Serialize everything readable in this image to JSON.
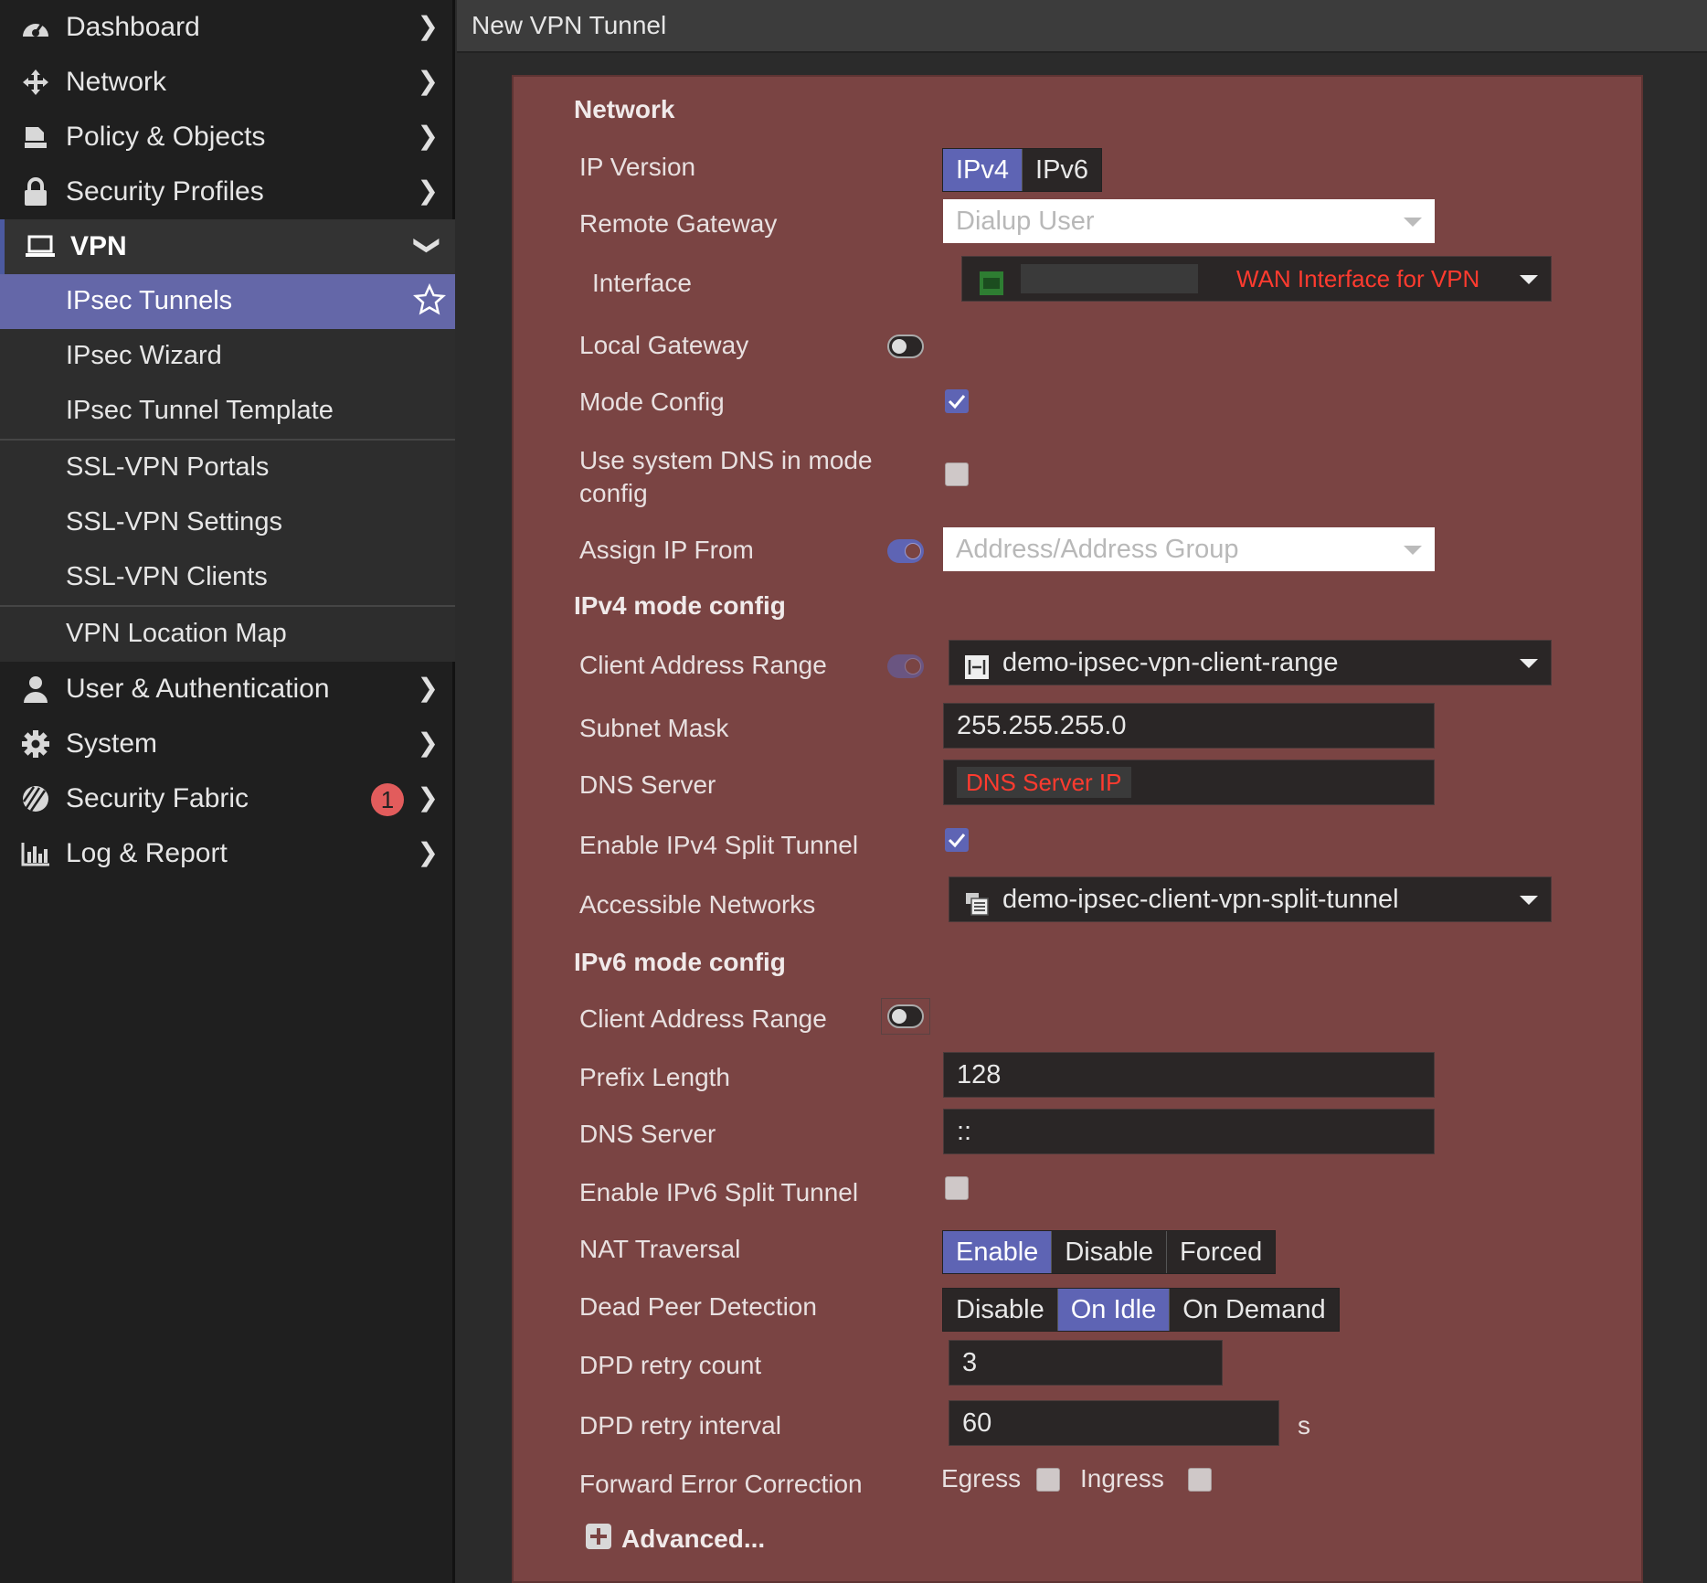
{
  "sidebar": {
    "items": [
      {
        "label": "Dashboard",
        "icon": "dashboard-icon"
      },
      {
        "label": "Network",
        "icon": "network-icon"
      },
      {
        "label": "Policy & Objects",
        "icon": "policy-icon"
      },
      {
        "label": "Security Profiles",
        "icon": "lock-icon"
      },
      {
        "label": "VPN",
        "icon": "laptop-icon"
      },
      {
        "label": "User & Authentication",
        "icon": "user-icon"
      },
      {
        "label": "System",
        "icon": "gear-icon"
      },
      {
        "label": "Security Fabric",
        "icon": "fabric-icon",
        "badge": "1"
      },
      {
        "label": "Log & Report",
        "icon": "chart-icon"
      }
    ],
    "vpn_sub": [
      {
        "label": "IPsec Tunnels"
      },
      {
        "label": "IPsec Wizard"
      },
      {
        "label": "IPsec Tunnel Template"
      },
      {
        "label": "SSL-VPN Portals"
      },
      {
        "label": "SSL-VPN Settings"
      },
      {
        "label": "SSL-VPN Clients"
      },
      {
        "label": "VPN Location Map"
      }
    ]
  },
  "header": {
    "title": "New VPN Tunnel"
  },
  "form": {
    "network_section": "Network",
    "ip_version_label": "IP Version",
    "ip_version_options": [
      "IPv4",
      "IPv6"
    ],
    "ip_version_selected": "IPv4",
    "remote_gateway_label": "Remote Gateway",
    "remote_gateway_value": "Dialup User",
    "interface_label": "Interface",
    "interface_annotation": "WAN Interface for VPN",
    "local_gateway_label": "Local Gateway",
    "mode_config_label": "Mode Config",
    "use_system_dns_label_1": "Use system DNS in mode",
    "use_system_dns_label_2": "config",
    "assign_ip_from_label": "Assign IP From",
    "assign_ip_from_value": "Address/Address Group",
    "ipv4_section": "IPv4 mode config",
    "client_address_range_label": "Client Address Range",
    "client_address_range_value": "demo-ipsec-vpn-client-range",
    "subnet_mask_label": "Subnet Mask",
    "subnet_mask_value": "255.255.255.0",
    "dns_server_label": "DNS Server",
    "dns_server_annotation": "DNS Server IP",
    "enable_ipv4_split_label": "Enable IPv4 Split Tunnel",
    "accessible_networks_label": "Accessible Networks",
    "accessible_networks_value": "demo-ipsec-client-vpn-split-tunnel",
    "ipv6_section": "IPv6 mode config",
    "ipv6_client_address_range_label": "Client Address Range",
    "prefix_length_label": "Prefix Length",
    "prefix_length_value": "128",
    "ipv6_dns_server_label": "DNS Server",
    "ipv6_dns_server_value": "::",
    "enable_ipv6_split_label": "Enable IPv6 Split Tunnel",
    "nat_traversal_label": "NAT Traversal",
    "nat_options": [
      "Enable",
      "Disable",
      "Forced"
    ],
    "nat_selected": "Enable",
    "dpd_label": "Dead Peer Detection",
    "dpd_options": [
      "Disable",
      "On Idle",
      "On Demand"
    ],
    "dpd_selected": "On Idle",
    "dpd_retry_count_label": "DPD retry count",
    "dpd_retry_count_value": "3",
    "dpd_retry_interval_label": "DPD retry interval",
    "dpd_retry_interval_value": "60",
    "dpd_retry_interval_unit": "s",
    "fec_label": "Forward Error Correction",
    "fec_egress": "Egress",
    "fec_ingress": "Ingress",
    "advanced_label": "Advanced..."
  },
  "colors": {
    "accent": "#5e64b4",
    "panel": "#7a4443",
    "annotation": "#ff3b2f"
  }
}
